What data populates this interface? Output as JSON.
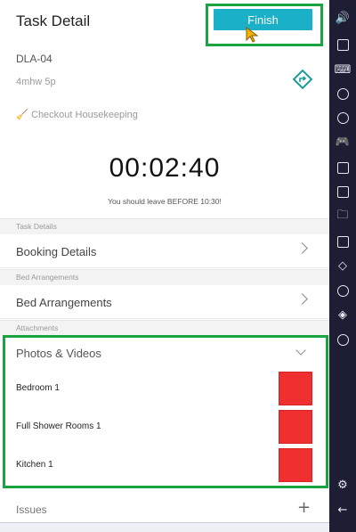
{
  "header": {
    "title": "Task Detail",
    "finish_label": "Finish"
  },
  "task": {
    "code": "DLA-04",
    "room": "4mhw 5p",
    "checkout_label": "Checkout Housekeeping"
  },
  "timer": {
    "value": "00:02:40",
    "leave_text": "You should leave BEFORE 10:30!"
  },
  "sections": {
    "task_details": {
      "header": "Task Details",
      "row": "Booking Details"
    },
    "bed": {
      "header": "Bed Arrangements",
      "row": "Bed Arrangements"
    },
    "attachments": {
      "header": "Attachments"
    }
  },
  "photos": {
    "title": "Photos & Videos",
    "items": [
      {
        "label": "Bedroom 1"
      },
      {
        "label": "Full Shower Rooms 1"
      },
      {
        "label": "Kitchen 1"
      }
    ]
  },
  "issues": {
    "label": "Issues"
  },
  "colors": {
    "finish": "#1ab0c7",
    "highlight": "#1aa43f",
    "thumbnail": "#f03030",
    "sidebar": "#1d1d33",
    "directions": "#1a9e9c"
  },
  "sidebar_icons": [
    "volume-up-icon",
    "volume-down-icon",
    "cursor-icon",
    "keyboard-icon",
    "video-play-icon",
    "screen-record-icon",
    "gamepad-icon",
    "apk-icon",
    "screenshot-icon",
    "folder-icon",
    "multi-instance-icon",
    "eraser-icon",
    "location-icon",
    "layers-icon",
    "speed-icon",
    "settings-icon",
    "back-icon"
  ]
}
